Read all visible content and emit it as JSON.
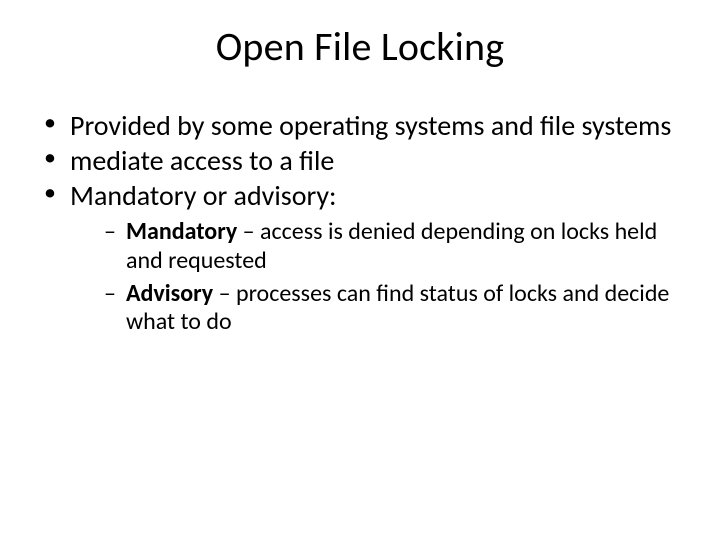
{
  "title": "Open File Locking",
  "bullets": [
    "Provided by some operating systems and file systems",
    "mediate access to a file",
    "Mandatory or advisory:"
  ],
  "sub": {
    "mandatory_label": "Mandatory",
    "mandatory_rest": " – access is denied depending on locks held and requested",
    "advisory_label": "Advisory",
    "advisory_rest": " – processes can find status of locks and decide what to do"
  }
}
